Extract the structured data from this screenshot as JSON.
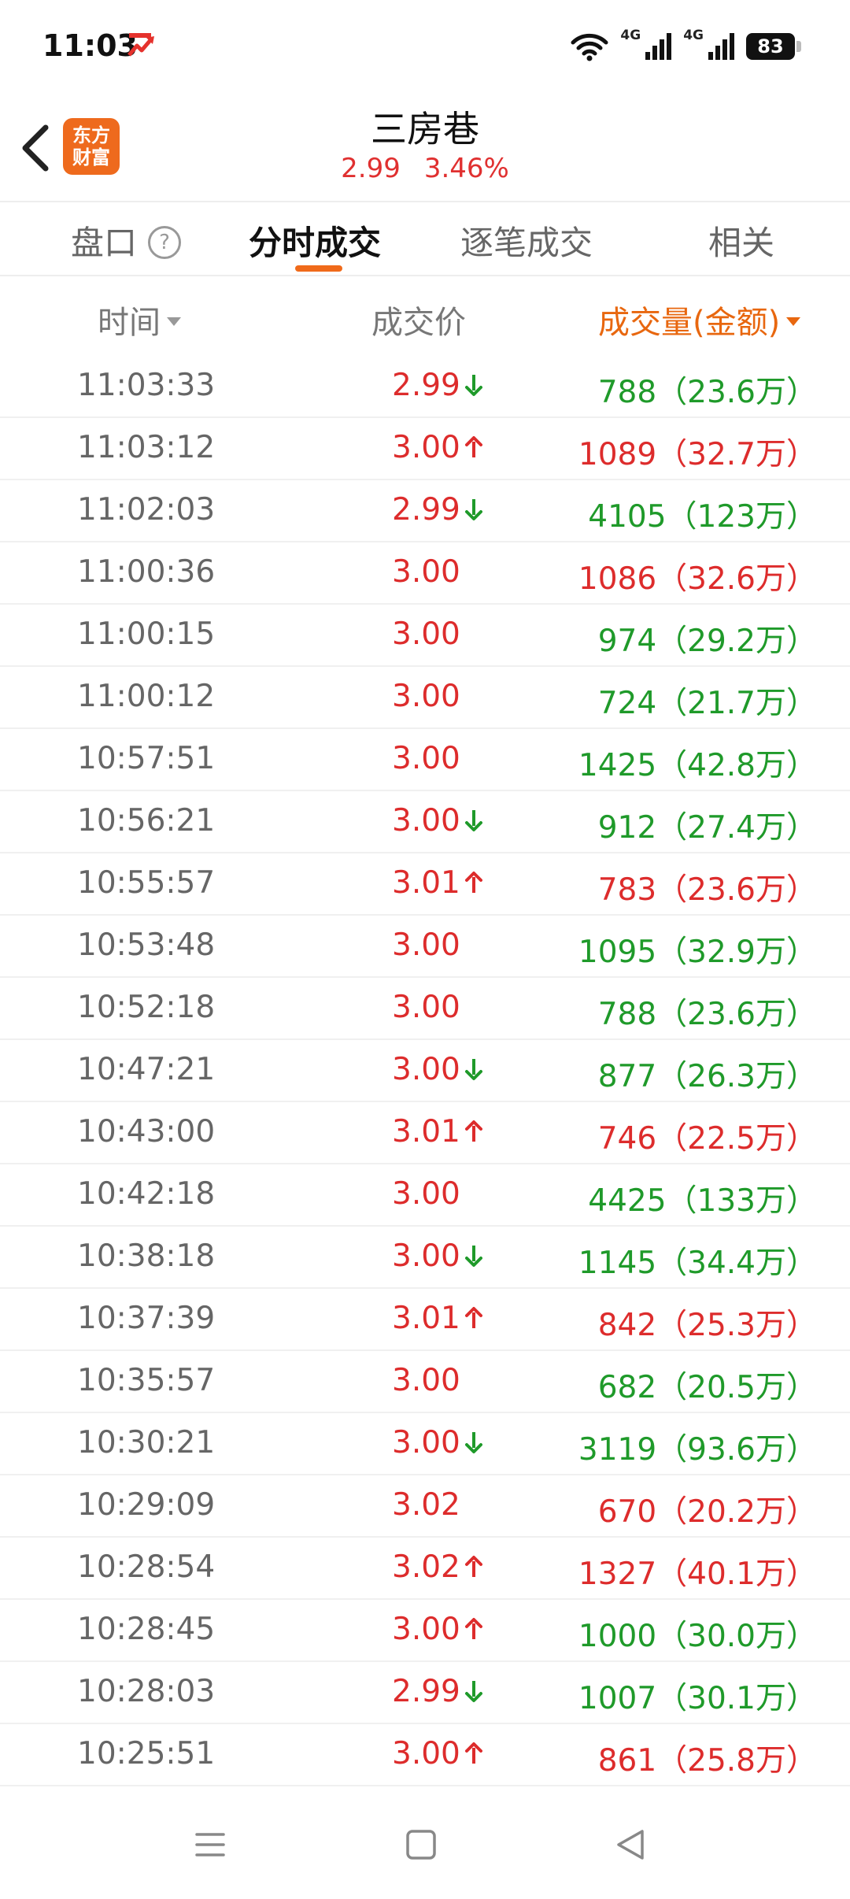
{
  "status": {
    "time": "11:03",
    "network1": "4G",
    "network2": "4G",
    "battery": "83"
  },
  "header": {
    "logo_line1": "东方",
    "logo_line2": "财富",
    "stock_name": "三房巷",
    "price": "2.99",
    "change_pct": "3.46%"
  },
  "tabs": [
    {
      "label": "盘口",
      "active": false
    },
    {
      "label": "分时成交",
      "active": true
    },
    {
      "label": "逐笔成交",
      "active": false
    },
    {
      "label": "相关",
      "active": false
    }
  ],
  "columns": {
    "time": "时间",
    "price": "成交价",
    "volume": "成交量(金额)"
  },
  "colors": {
    "up_red": "#dd2c2c",
    "down_green": "#1f9a2a",
    "accent_orange": "#e8670f"
  },
  "trades": [
    {
      "time": "11:03:33",
      "price": "2.99",
      "dir": "down",
      "vol": "788（23.6万）",
      "vol_color": "green"
    },
    {
      "time": "11:03:12",
      "price": "3.00",
      "dir": "up",
      "vol": "1089（32.7万）",
      "vol_color": "red"
    },
    {
      "time": "11:02:03",
      "price": "2.99",
      "dir": "down",
      "vol": "4105（123万）",
      "vol_color": "green"
    },
    {
      "time": "11:00:36",
      "price": "3.00",
      "dir": "",
      "vol": "1086（32.6万）",
      "vol_color": "red"
    },
    {
      "time": "11:00:15",
      "price": "3.00",
      "dir": "",
      "vol": "974（29.2万）",
      "vol_color": "green"
    },
    {
      "time": "11:00:12",
      "price": "3.00",
      "dir": "",
      "vol": "724（21.7万）",
      "vol_color": "green"
    },
    {
      "time": "10:57:51",
      "price": "3.00",
      "dir": "",
      "vol": "1425（42.8万）",
      "vol_color": "green"
    },
    {
      "time": "10:56:21",
      "price": "3.00",
      "dir": "down",
      "vol": "912（27.4万）",
      "vol_color": "green"
    },
    {
      "time": "10:55:57",
      "price": "3.01",
      "dir": "up",
      "vol": "783（23.6万）",
      "vol_color": "red"
    },
    {
      "time": "10:53:48",
      "price": "3.00",
      "dir": "",
      "vol": "1095（32.9万）",
      "vol_color": "green"
    },
    {
      "time": "10:52:18",
      "price": "3.00",
      "dir": "",
      "vol": "788（23.6万）",
      "vol_color": "green"
    },
    {
      "time": "10:47:21",
      "price": "3.00",
      "dir": "down",
      "vol": "877（26.3万）",
      "vol_color": "green"
    },
    {
      "time": "10:43:00",
      "price": "3.01",
      "dir": "up",
      "vol": "746（22.5万）",
      "vol_color": "red"
    },
    {
      "time": "10:42:18",
      "price": "3.00",
      "dir": "",
      "vol": "4425（133万）",
      "vol_color": "green"
    },
    {
      "time": "10:38:18",
      "price": "3.00",
      "dir": "down",
      "vol": "1145（34.4万）",
      "vol_color": "green"
    },
    {
      "time": "10:37:39",
      "price": "3.01",
      "dir": "up",
      "vol": "842（25.3万）",
      "vol_color": "red"
    },
    {
      "time": "10:35:57",
      "price": "3.00",
      "dir": "",
      "vol": "682（20.5万）",
      "vol_color": "green"
    },
    {
      "time": "10:30:21",
      "price": "3.00",
      "dir": "down",
      "vol": "3119（93.6万）",
      "vol_color": "green"
    },
    {
      "time": "10:29:09",
      "price": "3.02",
      "dir": "",
      "vol": "670（20.2万）",
      "vol_color": "red"
    },
    {
      "time": "10:28:54",
      "price": "3.02",
      "dir": "up",
      "vol": "1327（40.1万）",
      "vol_color": "red"
    },
    {
      "time": "10:28:45",
      "price": "3.00",
      "dir": "up",
      "vol": "1000（30.0万）",
      "vol_color": "green"
    },
    {
      "time": "10:28:03",
      "price": "2.99",
      "dir": "down",
      "vol": "1007（30.1万）",
      "vol_color": "green"
    },
    {
      "time": "10:25:51",
      "price": "3.00",
      "dir": "up",
      "vol": "861（25.8万）",
      "vol_color": "red"
    }
  ]
}
